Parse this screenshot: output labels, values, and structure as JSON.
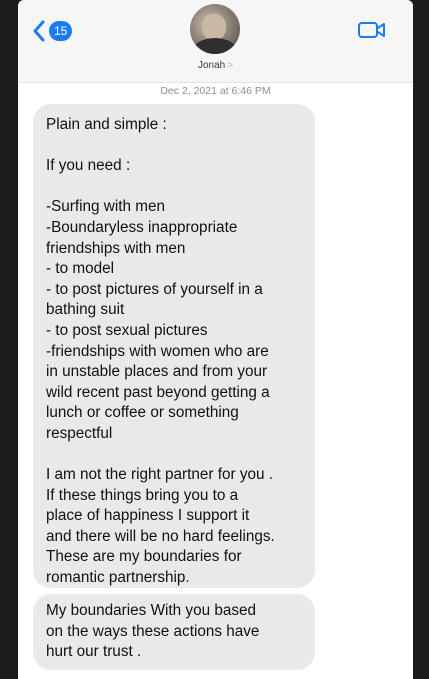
{
  "nav": {
    "back_badge": "15",
    "contact_name": "Jonah",
    "contact_chevron": ">",
    "back_icon": "chevron-left-icon",
    "video_icon": "video-camera-icon"
  },
  "colors": {
    "accent": "#1a7cf5",
    "bubble": "#e9e9eb",
    "header": "#f6f6f7"
  },
  "conversation": {
    "timestamp": "Dec 2, 2021 at 6:46 PM",
    "messages": [
      {
        "lines": [
          "Plain and simple :",
          "",
          "If you need :",
          "",
          "-Surfing with men",
          "-Boundaryless inappropriate",
          "friendships with men",
          "- to model",
          "- to post pictures of yourself in a",
          "bathing suit",
          "- to post sexual pictures",
          "-friendships with women who are",
          "in unstable places and from your",
          "wild recent past beyond getting a",
          "lunch or coffee or something",
          "respectful",
          "",
          "I am not the right partner for you .",
          "If these things bring you to a",
          "place of happiness I support it",
          "and there will be no hard feelings.",
          "These are my boundaries for",
          "romantic partnership."
        ]
      },
      {
        "lines": [
          "My boundaries With you based",
          "on the ways these actions have",
          "hurt our trust ."
        ]
      }
    ]
  }
}
